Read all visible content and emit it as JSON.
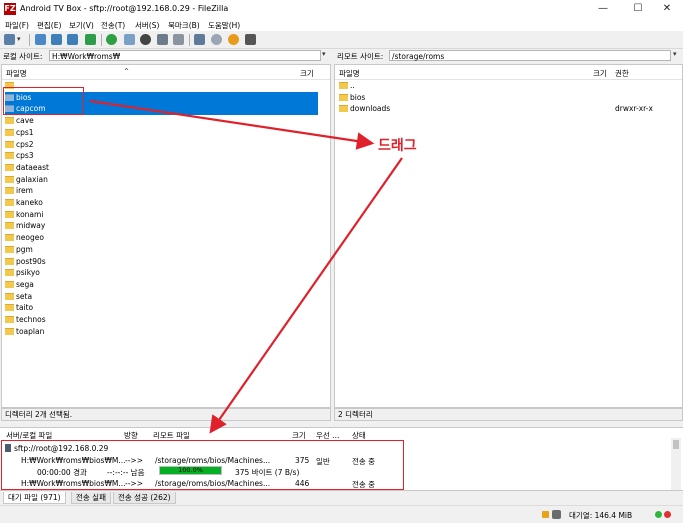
{
  "window": {
    "title": "Android TV Box - sftp://root@192.168.0.29 - FileZilla",
    "app_icon": "FZ",
    "min_label": "—",
    "max_label": "☐",
    "close_label": "✕"
  },
  "menu": [
    "파일(F)",
    "편집(E)",
    "보기(V)",
    "전송(T)",
    "서버(S)",
    "북마크(B)",
    "도움말(H)"
  ],
  "local": {
    "site_label": "로컬 사이트:",
    "path": "H:₩Work₩roms₩",
    "col_name": "파일명",
    "col_size": "크기",
    "items": [
      {
        "name": ".."
      },
      {
        "name": "bios",
        "selected": true
      },
      {
        "name": "capcom",
        "selected": true
      },
      {
        "name": "cave"
      },
      {
        "name": "cps1"
      },
      {
        "name": "cps2"
      },
      {
        "name": "cps3"
      },
      {
        "name": "dataeast"
      },
      {
        "name": "galaxian"
      },
      {
        "name": "irem"
      },
      {
        "name": "kaneko"
      },
      {
        "name": "konami"
      },
      {
        "name": "midway"
      },
      {
        "name": "neogeo"
      },
      {
        "name": "pgm"
      },
      {
        "name": "post90s"
      },
      {
        "name": "psikyo"
      },
      {
        "name": "sega"
      },
      {
        "name": "seta"
      },
      {
        "name": "taito"
      },
      {
        "name": "technos"
      },
      {
        "name": "toaplan"
      }
    ],
    "status": "디렉터리 2개 선택됨."
  },
  "remote": {
    "site_label": "리모트 사이트:",
    "path": "/storage/roms",
    "col_name": "파일명",
    "col_size": "크기",
    "col_perm": "권한",
    "items": [
      {
        "name": "..",
        "perm": ""
      },
      {
        "name": "bios",
        "perm": ""
      },
      {
        "name": "downloads",
        "perm": "drwxr-xr-x"
      }
    ],
    "status": "2 디렉터리"
  },
  "annotation": {
    "drag_label": "드래그",
    "color": "#e0202a"
  },
  "queue": {
    "headers": [
      "서버/로컬 파일",
      "방향",
      "리모트 파일",
      "크기",
      "우선 ...",
      "상태"
    ],
    "server": "sftp://root@192.168.0.29",
    "rows": [
      {
        "local": "H:₩Work₩roms₩bios₩M...",
        "dir": "-->>",
        "remote": "/storage/roms/bios/Machines...",
        "size": "375",
        "priority": "일반",
        "status": "전송 중"
      },
      {
        "local": "H:₩Work₩roms₩bios₩M...",
        "dir": "-->>",
        "remote": "/storage/roms/bios/Machines...",
        "size": "446",
        "priority": "",
        "status": "전송 중"
      }
    ],
    "progress": {
      "elapsed": "00:00:00 경과",
      "remaining": "--:--:-- 남음",
      "percent_label": "100.0%",
      "percent": 100,
      "transferred": "375 바이트 (7 B/s)"
    }
  },
  "tabs": [
    "대기 파일 (971)",
    "전송 실패",
    "전송 성공 (262)"
  ],
  "statusbar": {
    "queue_label": "대기열: 146.4 MiB"
  }
}
